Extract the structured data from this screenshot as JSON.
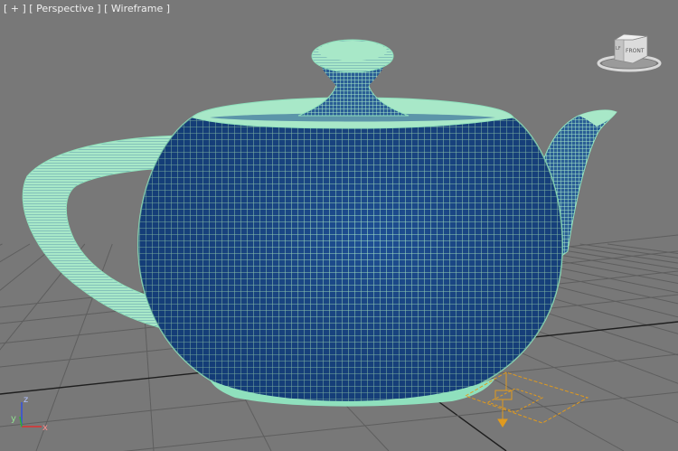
{
  "viewport": {
    "label_open": "[ ",
    "label_plus": "+",
    "label_sep1": " ] [ ",
    "label_view": "Perspective",
    "label_sep2": " ] [ ",
    "label_shading": "Wireframe",
    "label_close": " ]"
  },
  "viewcube": {
    "front_label": "FRONT",
    "left_label": "LF"
  },
  "axis_gizmo": {
    "x_label": "x",
    "y_label": "y",
    "z_label": "z"
  },
  "colors": {
    "background": "#787878",
    "grid": "#5e5e5e",
    "grid_axis": "#1e1e1e",
    "teapot_fill": "#1e4f94",
    "teapot_wire": "#a8e8c8",
    "teapot_rim": "#8fe0bd",
    "light_icon": "#e09a1e",
    "axis_x": "#e03030",
    "axis_y": "#30b030",
    "axis_z": "#3050e0"
  }
}
